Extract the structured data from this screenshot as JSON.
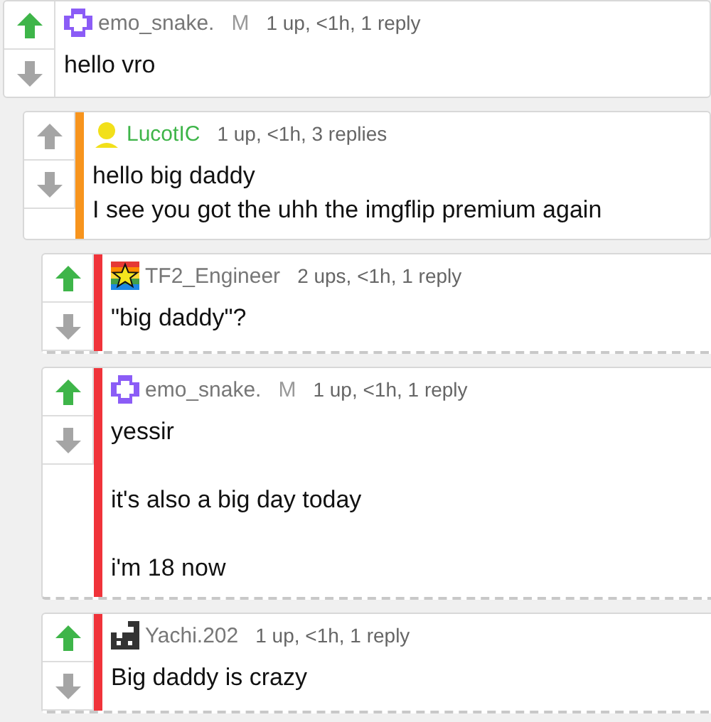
{
  "comments": [
    {
      "username": "emo_snake.",
      "badge": "M",
      "name_highlighted": false,
      "meta": "1 up, <1h, 1 reply",
      "body": "hello vro",
      "upvoted": true,
      "avatar": {
        "kind": "cross"
      },
      "children": [
        {
          "username": "LucotIC",
          "name_highlighted": true,
          "meta": "1 up, <1h, 3 replies",
          "body": "hello big daddy\nI see you got the uhh the imgflip premium again",
          "upvoted": false,
          "color": "#f7941d",
          "avatar": {
            "kind": "person"
          },
          "children": [
            {
              "username": "TF2_Engineer",
              "name_highlighted": false,
              "meta": "2 ups, <1h, 1 reply",
              "body": "\"big daddy\"?",
              "upvoted": true,
              "color": "#f0333a",
              "avatar": {
                "kind": "star"
              }
            },
            {
              "username": "emo_snake.",
              "badge": "M",
              "name_highlighted": false,
              "meta": "1 up, <1h, 1 reply",
              "body": "yessir\n\nit's also a big day today\n\ni'm 18 now",
              "upvoted": true,
              "color": "#f0333a",
              "avatar": {
                "kind": "cross"
              }
            },
            {
              "username": "Yachi.202",
              "name_highlighted": false,
              "meta": "1 up, <1h, 1 reply",
              "body": "Big daddy is crazy",
              "upvoted": true,
              "color": "#f0333a",
              "avatar": {
                "kind": "pixel"
              }
            }
          ]
        }
      ]
    }
  ]
}
